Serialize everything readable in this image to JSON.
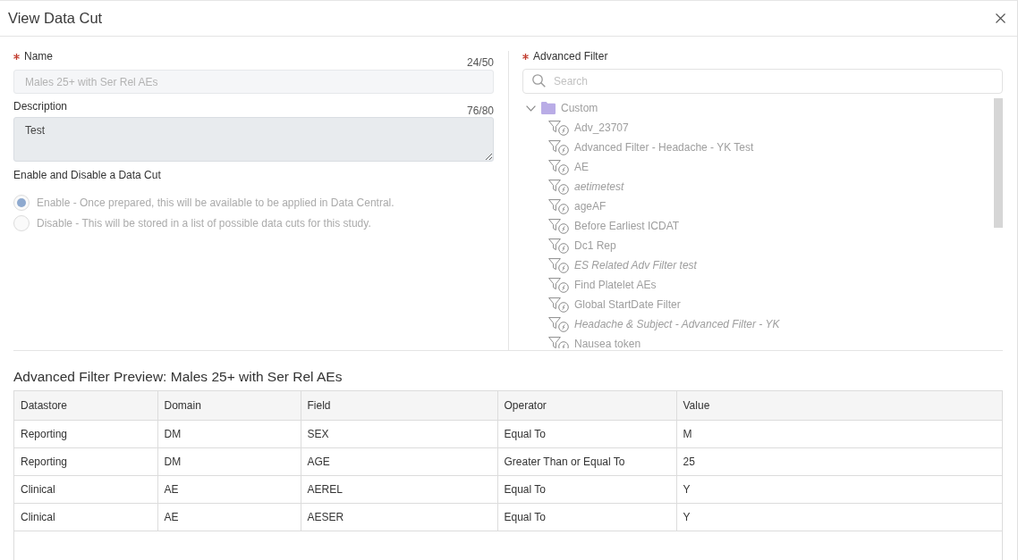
{
  "dialog": {
    "title": "View Data Cut"
  },
  "name_field": {
    "label": "Name",
    "required": true,
    "counter": "24/50",
    "value": "Males 25+ with Ser Rel AEs",
    "disabled": true
  },
  "description_field": {
    "label": "Description",
    "required": false,
    "counter": "76/80",
    "value": "Test"
  },
  "status_group": {
    "label": "Enable and Disable a Data Cut",
    "disabled": true,
    "options": [
      {
        "label": "Enable - Once prepared, this will be available to be applied in Data Central.",
        "selected": true
      },
      {
        "label": "Disable - This will be stored in a list of possible data cuts for this study.",
        "selected": false
      }
    ]
  },
  "advanced_filter": {
    "label": "Advanced Filter",
    "required": true,
    "search": {
      "placeholder": "Search"
    },
    "tree": [
      {
        "label": "Custom",
        "expanded": true,
        "children": [
          {
            "label": "Adv_23707",
            "italic": false
          },
          {
            "label": "Advanced Filter - Headache - YK Test",
            "italic": false
          },
          {
            "label": "AE",
            "italic": false
          },
          {
            "label": "aetimetest",
            "italic": true
          },
          {
            "label": "ageAF",
            "italic": false
          },
          {
            "label": "Before Earliest ICDAT",
            "italic": false
          },
          {
            "label": "Dc1 Rep",
            "italic": false
          },
          {
            "label": "ES Related Adv Filter test",
            "italic": true
          },
          {
            "label": "Find Platelet AEs",
            "italic": false
          },
          {
            "label": "Global StartDate Filter",
            "italic": false
          },
          {
            "label": "Headache & Subject - Advanced Filter - YK",
            "italic": true
          },
          {
            "label": "Nausea token",
            "italic": false
          }
        ]
      }
    ]
  },
  "preview": {
    "title": "Advanced Filter Preview: Males 25+ with Ser Rel AEs",
    "table": {
      "columns": [
        "Datastore",
        "Domain",
        "Field",
        "Operator",
        "Value"
      ],
      "rows": [
        [
          "Reporting",
          "DM",
          "SEX",
          "Equal To",
          "M"
        ],
        [
          "Reporting",
          "DM",
          "AGE",
          "Greater Than or Equal To",
          "25"
        ],
        [
          "Clinical",
          "AE",
          "AEREL",
          "Equal To",
          "Y"
        ],
        [
          "Clinical",
          "AE",
          "AESER",
          "Equal To",
          "Y"
        ]
      ]
    }
  }
}
